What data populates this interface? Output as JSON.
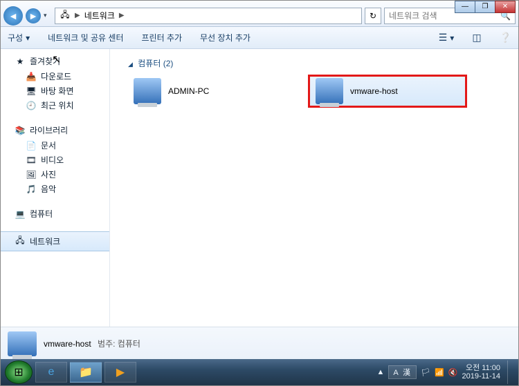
{
  "window_controls": {
    "min": "—",
    "max": "❐",
    "close": "✕"
  },
  "address": {
    "location": "네트워크",
    "sep": "▶",
    "refresh": "↻"
  },
  "search": {
    "placeholder": "네트워크 검색"
  },
  "toolbar": {
    "organize": "구성",
    "organize_caret": "▾",
    "network_center": "네트워크 및 공유 센터",
    "add_printer": "프린터 추가",
    "add_wireless": "무선 장치 추가"
  },
  "sidebar": {
    "favorites": {
      "label": "즐겨찾기",
      "items": [
        "다운로드",
        "바탕 화면",
        "최근 위치"
      ]
    },
    "libraries": {
      "label": "라이브러리",
      "items": [
        "문서",
        "비디오",
        "사진",
        "음악"
      ]
    },
    "computer": {
      "label": "컴퓨터"
    },
    "network": {
      "label": "네트워크"
    }
  },
  "content": {
    "group_label": "컴퓨터 (2)",
    "items": [
      {
        "name": "ADMIN-PC",
        "selected": false
      },
      {
        "name": "vmware-host",
        "selected": true
      }
    ]
  },
  "details": {
    "name": "vmware-host",
    "category_label": "범주:",
    "category_value": "컴퓨터"
  },
  "tray": {
    "lang": "A 漢",
    "time": "오전 11:00",
    "date": "2019-11-14"
  }
}
